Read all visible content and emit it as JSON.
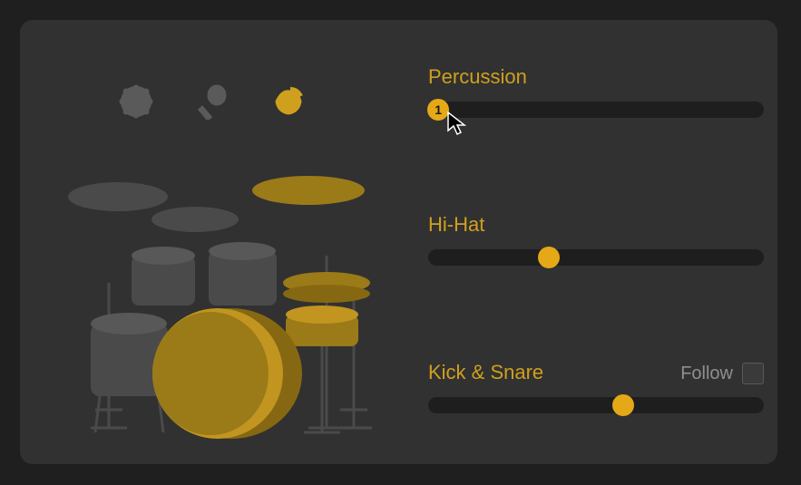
{
  "colors": {
    "accent": "#e5a817",
    "label": "#cfa01e",
    "panel": "#313131",
    "track": "#1e1e1e",
    "muted": "#8f8f8f"
  },
  "percussion_icons": [
    {
      "name": "tambourine-icon",
      "active": false
    },
    {
      "name": "maraca-icon",
      "active": false
    },
    {
      "name": "claps-icon",
      "active": true
    }
  ],
  "sliders": {
    "percussion": {
      "label": "Percussion",
      "value_text": "1",
      "position_pct": 3
    },
    "hihat": {
      "label": "Hi-Hat",
      "position_pct": 36
    },
    "kick_snare": {
      "label": "Kick & Snare",
      "position_pct": 58,
      "follow_label": "Follow",
      "follow_checked": false
    }
  }
}
